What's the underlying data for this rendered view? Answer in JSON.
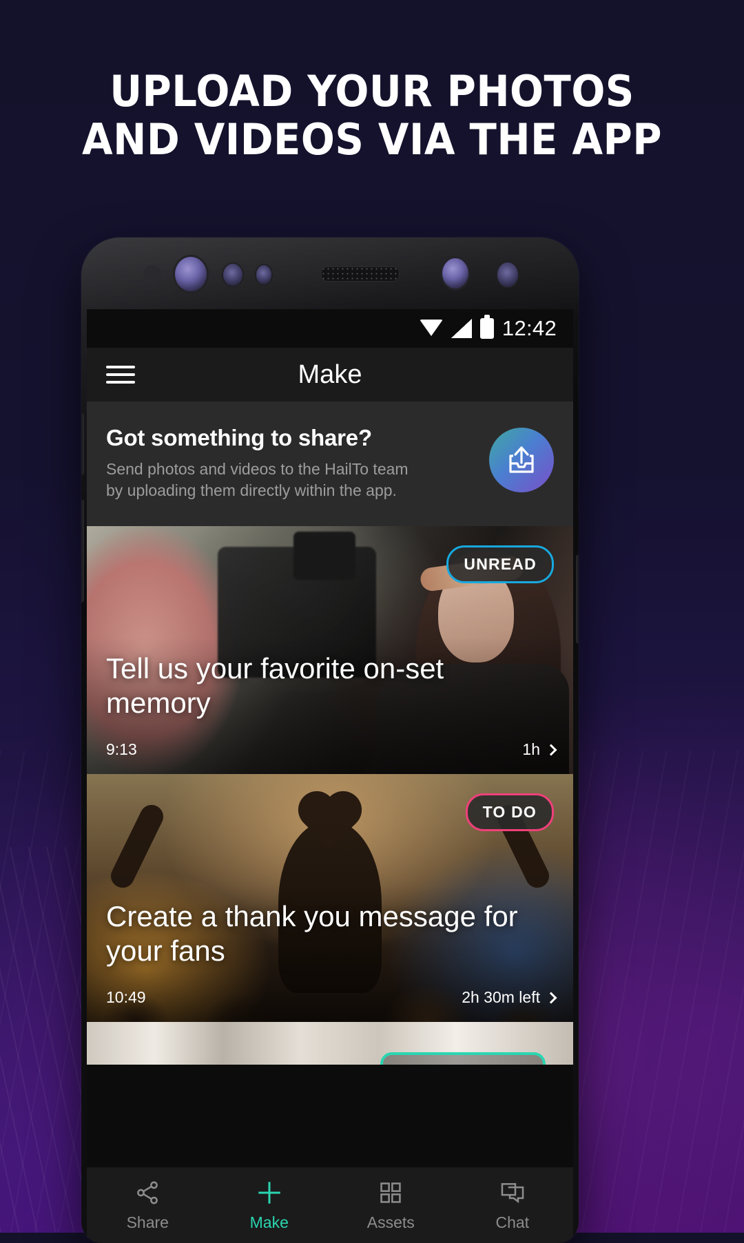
{
  "promo_headline": {
    "line1": "UPLOAD YOUR PHOTOS",
    "line2": "AND VIDEOS VIA THE APP"
  },
  "phone": {
    "status_bar": {
      "time": "12:42",
      "icons": [
        "wifi-icon",
        "cell-signal-icon",
        "battery-icon"
      ]
    },
    "app_bar": {
      "menu_icon": "hamburger-menu-icon",
      "title": "Make"
    },
    "upload_card": {
      "title": "Got something to share?",
      "subtitle_line1": "Send photos and videos to the HailTo team",
      "subtitle_line2": "by uploading them directly within the app.",
      "button_icon": "upload-icon"
    },
    "cards": [
      {
        "badge": "UNREAD",
        "badge_color": "#17a9e0",
        "title": "Tell us your favorite on-set memory",
        "time": "9:13",
        "due": "1h"
      },
      {
        "badge": "TO DO",
        "badge_color": "#f0407a",
        "title": "Create a thank you message for your fans",
        "time": "10:49",
        "due": "2h 30m left"
      }
    ],
    "bottom_nav": [
      {
        "label": "Share",
        "icon": "share-icon",
        "active": false
      },
      {
        "label": "Make",
        "icon": "plus-icon",
        "active": true
      },
      {
        "label": "Assets",
        "icon": "grid-icon",
        "active": false
      },
      {
        "label": "Chat",
        "icon": "chat-icon",
        "active": false
      }
    ]
  },
  "colors": {
    "accent_teal": "#2bd5b0",
    "badge_unread": "#17a9e0",
    "badge_todo": "#f0407a",
    "app_bar_bg": "#1b1b1b",
    "promo_card_bg": "#2b2b2b"
  }
}
